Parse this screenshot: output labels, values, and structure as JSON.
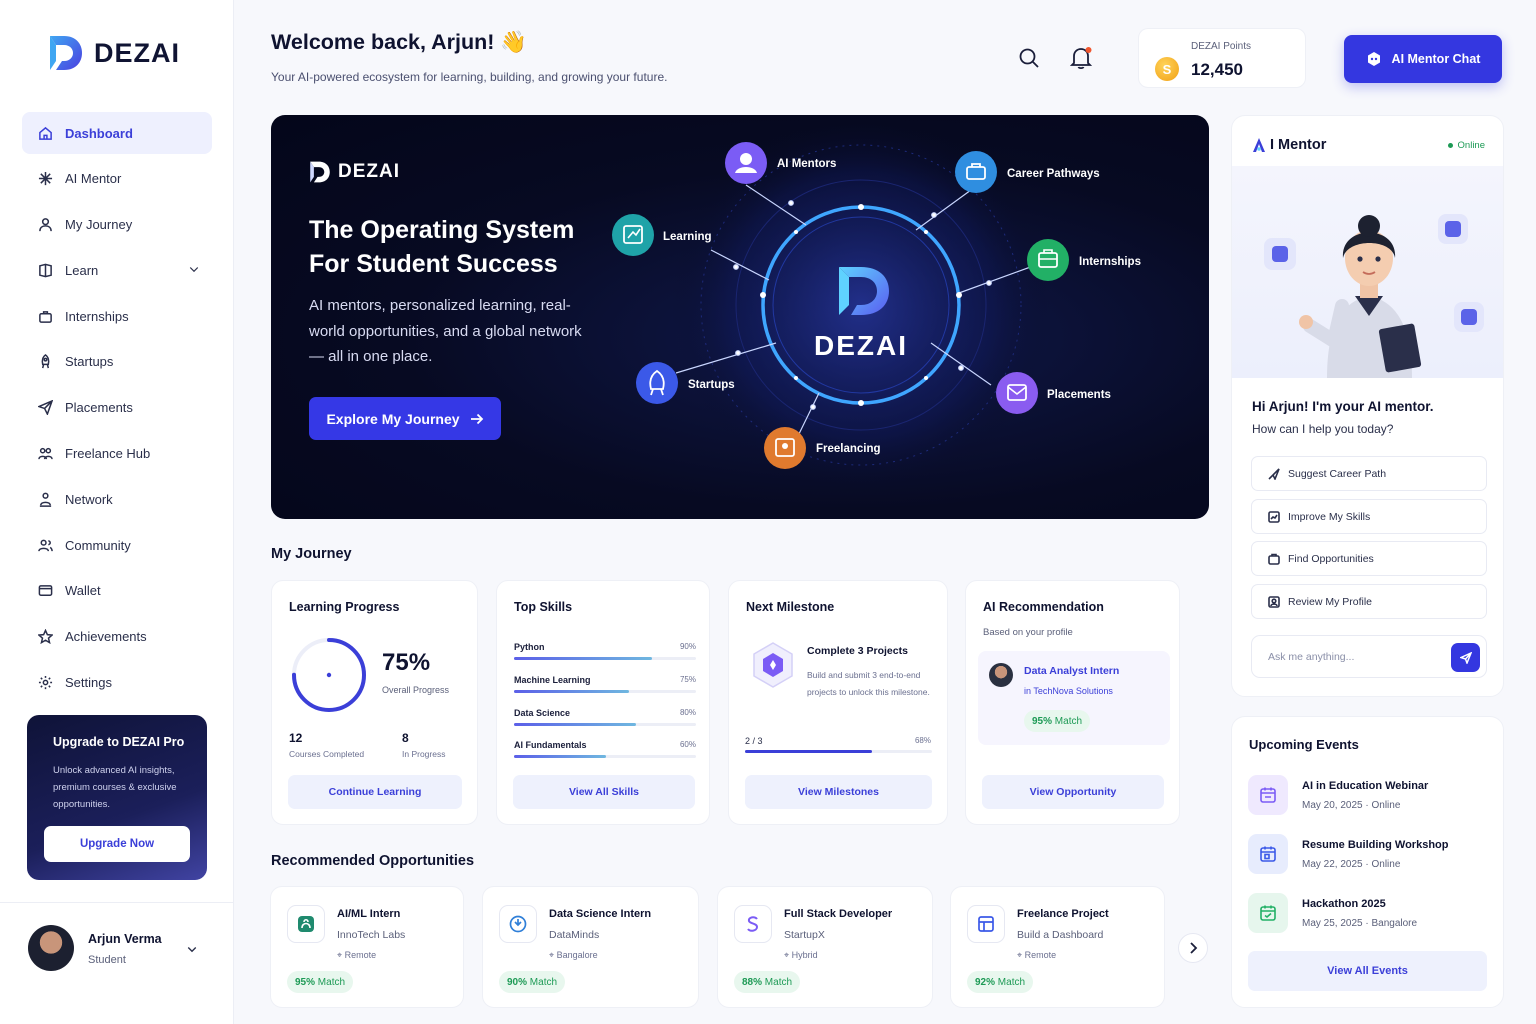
{
  "brand": {
    "name": "DEZAI"
  },
  "sidebar": {
    "items": [
      {
        "label": "Dashboard",
        "icon": "home-icon"
      },
      {
        "label": "AI Mentor",
        "icon": "sparkle-icon"
      },
      {
        "label": "My Journey",
        "icon": "user-icon"
      },
      {
        "label": "Learn",
        "icon": "book-icon"
      },
      {
        "label": "Internships",
        "icon": "briefcase-icon"
      },
      {
        "label": "Startups",
        "icon": "rocket-icon"
      },
      {
        "label": "Placements",
        "icon": "send-icon"
      },
      {
        "label": "Freelance Hub",
        "icon": "people-icon"
      },
      {
        "label": "Network",
        "icon": "network-icon"
      },
      {
        "label": "Community",
        "icon": "community-icon"
      },
      {
        "label": "Wallet",
        "icon": "wallet-icon"
      },
      {
        "label": "Achievements",
        "icon": "star-icon"
      },
      {
        "label": "Settings",
        "icon": "gear-icon"
      }
    ],
    "upgrade": {
      "title": "Upgrade to DEZAI Pro",
      "desc": "Unlock advanced AI insights, premium courses & exclusive opportunities.",
      "button": "Upgrade Now"
    },
    "profile": {
      "name": "Arjun Verma",
      "role": "Student"
    }
  },
  "header": {
    "welcome": "Welcome back, Arjun! 👋",
    "subtitle": "Your AI-powered ecosystem for learning, building, and growing your future.",
    "points_label": "DEZAI Points",
    "points_value": "12,450",
    "coin_symbol": "S",
    "mentor_button": "AI Mentor Chat"
  },
  "hero": {
    "logo_text": "DEZAI",
    "title": "The Operating System For Student Success",
    "desc": "AI mentors, personalized learning, real-world opportunities, and a global network — all in one place.",
    "button": "Explore My Journey",
    "center_label": "DEZAI",
    "nodes": [
      {
        "label": "AI Mentors",
        "color": "#7b5cf5"
      },
      {
        "label": "Career Pathways",
        "color": "#2f8ee0"
      },
      {
        "label": "Learning",
        "color": "#1fa3a8"
      },
      {
        "label": "Internships",
        "color": "#22b066"
      },
      {
        "label": "Startups",
        "color": "#3b59e8"
      },
      {
        "label": "Placements",
        "color": "#8a5cf0"
      },
      {
        "label": "Freelancing",
        "color": "#e07a2e"
      }
    ]
  },
  "journey": {
    "section_title": "My Journey",
    "progress": {
      "title": "Learning Progress",
      "percent": "75%",
      "percent_value": 0.75,
      "percent_label": "Overall Progress",
      "completed": "12",
      "completed_label": "Courses Completed",
      "in_progress": "8",
      "in_progress_label": "In Progress",
      "button": "Continue Learning"
    },
    "skills": {
      "title": "Top Skills",
      "items": [
        {
          "name": "Python",
          "pct": "90%",
          "value": 0.9
        },
        {
          "name": "Machine Learning",
          "pct": "75%",
          "value": 0.75
        },
        {
          "name": "Data Science",
          "pct": "80%",
          "value": 0.8
        },
        {
          "name": "AI Fundamentals",
          "pct": "60%",
          "value": 0.6
        }
      ],
      "button": "View All Skills"
    },
    "milestone": {
      "title": "Next Milestone",
      "name": "Complete 3 Projects",
      "desc": "Build and submit 3 end-to-end projects to unlock this milestone.",
      "count": "2 / 3",
      "pct": "68%",
      "value": 0.68,
      "button": "View Milestones"
    },
    "recommendation": {
      "title": "AI Recommendation",
      "sub": "Based on your profile",
      "role": "Data Analyst Intern",
      "company": "in TechNova Solutions",
      "match_num": "95%",
      "match_word": "Match",
      "button": "View Opportunity"
    }
  },
  "opportunities": {
    "section_title": "Recommended Opportunities",
    "items": [
      {
        "title": "AI/ML Intern",
        "company": "InnoTech Labs",
        "location": "Remote",
        "match": "95%",
        "match_word": "Match"
      },
      {
        "title": "Data Science Intern",
        "company": "DataMinds",
        "location": "Bangalore",
        "match": "90%",
        "match_word": "Match"
      },
      {
        "title": "Full Stack Developer",
        "company": "StartupX",
        "location": "Hybrid",
        "match": "88%",
        "match_word": "Match"
      },
      {
        "title": "Freelance Project",
        "company": "Build a Dashboard",
        "location": "Remote",
        "match": "92%",
        "match_word": "Match"
      }
    ]
  },
  "mentor": {
    "title_a": "A",
    "title_b": "I Mentor",
    "status": "Online",
    "greeting": "Hi Arjun! I'm your AI mentor.",
    "question": "How can I help you today?",
    "suggestions": [
      "Suggest Career Path",
      "Improve My Skills",
      "Find Opportunities",
      "Review My Profile"
    ],
    "placeholder": "Ask me anything..."
  },
  "events": {
    "title": "Upcoming Events",
    "items": [
      {
        "title": "AI in Education Webinar",
        "date": "May 20, 2025 · Online",
        "color": "#7b5cf5"
      },
      {
        "title": "Resume Building Workshop",
        "date": "May 22, 2025 · Online",
        "color": "#3b59e8"
      },
      {
        "title": "Hackathon 2025",
        "date": "May 25, 2025 · Bangalore",
        "color": "#22b066"
      }
    ],
    "button": "View All Events"
  }
}
